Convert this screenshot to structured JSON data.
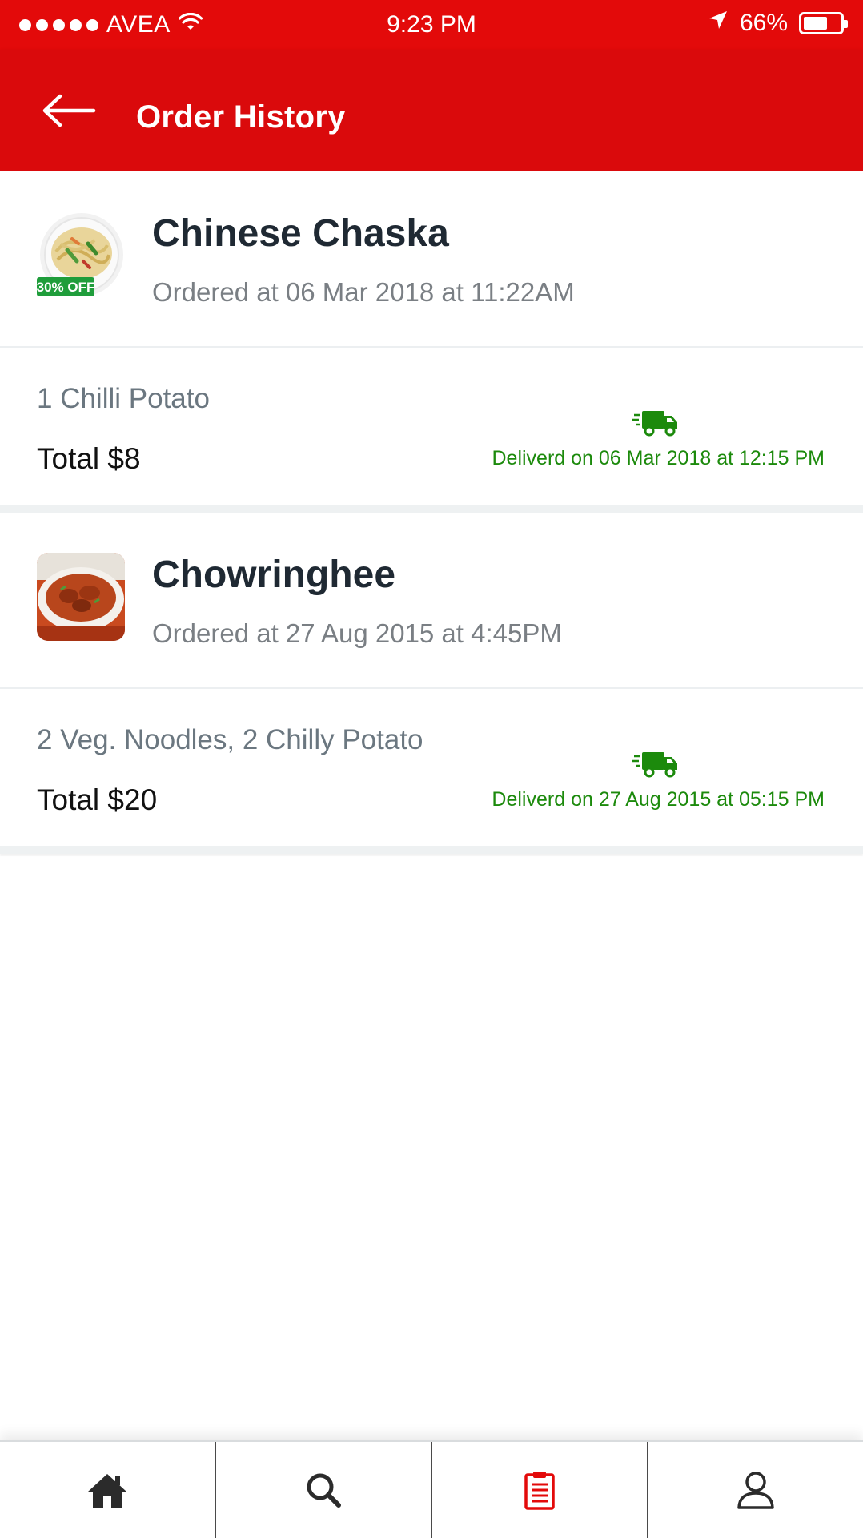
{
  "status_bar": {
    "carrier": "AVEA",
    "time": "9:23 PM",
    "battery": "66%",
    "battery_level": 0.66
  },
  "header": {
    "title": "Order History"
  },
  "orders": [
    {
      "restaurant": "Chinese Chaska",
      "ordered_at": "Ordered at 06 Mar 2018 at 11:22AM",
      "badge": "30% OFF",
      "items": "1 Chilli Potato",
      "total": "Total $8",
      "delivered": "Deliverd on 06 Mar 2018 at 12:15 PM"
    },
    {
      "restaurant": "Chowringhee",
      "ordered_at": "Ordered at 27 Aug 2015 at 4:45PM",
      "items": "2 Veg. Noodles, 2 Chilly Potato",
      "total": "Total $20",
      "delivered": "Deliverd on 27 Aug 2015 at 05:15 PM"
    }
  ],
  "bottom_nav": [
    {
      "icon": "home-icon",
      "active": false
    },
    {
      "icon": "search-icon",
      "active": false
    },
    {
      "icon": "clipboard-icon",
      "active": true
    },
    {
      "icon": "user-icon",
      "active": false
    }
  ],
  "colors": {
    "brand_red": "#da0a0c",
    "status_red": "#e30a0a",
    "delivered_green": "#1c8a0c",
    "active_nav": "#e30a0a",
    "inactive_nav": "#2b2b2b"
  }
}
